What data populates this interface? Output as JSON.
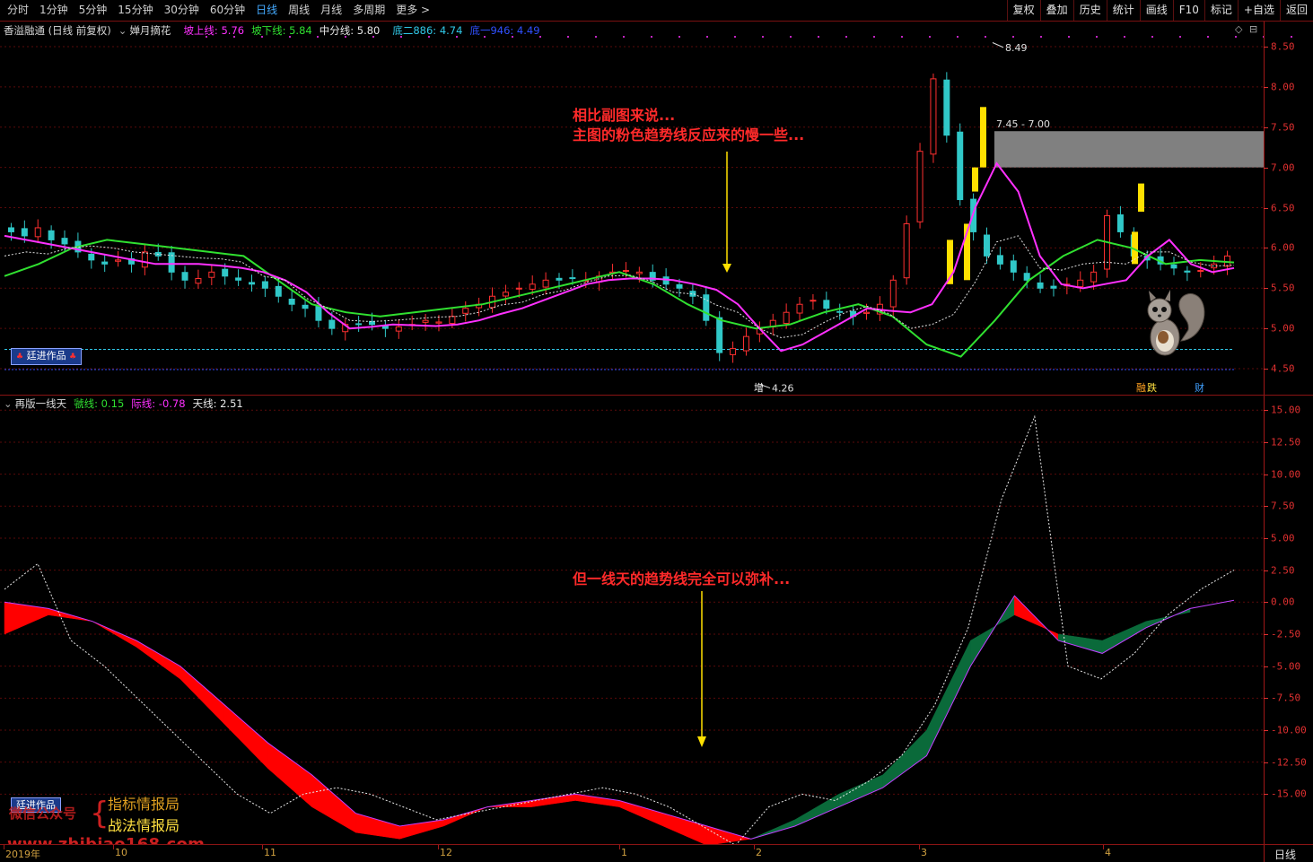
{
  "toolbar": {
    "periods": [
      "分时",
      "1分钟",
      "5分钟",
      "15分钟",
      "30分钟",
      "60分钟",
      "日线",
      "周线",
      "月线",
      "多周期",
      "更多 >"
    ],
    "active_period": "日线",
    "actions": [
      "复权",
      "叠加",
      "历史",
      "统计",
      "画线",
      "F10",
      "标记",
      "+自选",
      "返回"
    ]
  },
  "main_header": {
    "stock": "香溢融通 (日线 前复权)",
    "indicator_name": "婵月摘花",
    "line1_label": "坡上线: 5.76",
    "line2_label": "坡下线: 5.84",
    "line3_label": "中分线: 5.80",
    "line4_label": "底二886: 4.74",
    "line5_label": "底一946: 4.49"
  },
  "sub_header": {
    "indicator_name": "再版一线天",
    "line1_label": "虢线: 0.15",
    "line2_label": "际线: -0.78",
    "line3_label": "天线: 2.51"
  },
  "main_axis": [
    "8.50",
    "8.00",
    "7.50",
    "7.00",
    "6.50",
    "6.00",
    "5.50",
    "5.00",
    "4.50"
  ],
  "sub_axis": [
    "15.00",
    "12.50",
    "10.00",
    "7.50",
    "5.00",
    "2.50",
    "0.00",
    "-2.50",
    "-5.00",
    "-7.50",
    "-10.00",
    "-12.50",
    "-15.00"
  ],
  "x_axis": {
    "labels": [
      "2019年",
      "10",
      "11",
      "12",
      "1",
      "2",
      "3",
      "4"
    ],
    "period_label": "日线"
  },
  "chart_marks": {
    "high_label": "8.49",
    "low_label": "4.26",
    "zone_label": "7.45 - 7.00",
    "event_zeng": "增",
    "event_rong": "融",
    "event_die": "跌",
    "event_cai": "财"
  },
  "annotations": {
    "main_line1": "相比副图来说...",
    "main_line2": "主图的粉色趋势线反应来的慢一些...",
    "sub_line1": "但一线天的趋势线完全可以弥补..."
  },
  "badges": {
    "author_main": "廷进作品",
    "author_sub": "廷进作品"
  },
  "watermark": {
    "left_text": "微信公众号",
    "brace": "{",
    "line1": "指标情报局",
    "line2": "战法情报局",
    "url": "www.zhibiao168.com"
  },
  "colors": {
    "up": "#ff3030",
    "down": "#30c8c8",
    "pink": "#ff30ff",
    "green": "#30e030",
    "yellow": "#ffe000",
    "red_fill": "#ff0000",
    "green_fill": "#0a6a3a",
    "axis": "#e03030"
  },
  "chart_data": {
    "type": "candlestick",
    "main": {
      "ylim": [
        4.3,
        8.6
      ],
      "close": [
        6.2,
        6.15,
        6.25,
        6.1,
        6.05,
        5.95,
        5.85,
        5.8,
        5.85,
        5.8,
        5.95,
        5.9,
        5.7,
        5.6,
        5.62,
        5.7,
        5.65,
        5.6,
        5.55,
        5.5,
        5.4,
        5.3,
        5.25,
        5.1,
        5.0,
        5.05,
        5.05,
        5.05,
        5.0,
        5.02,
        5.05,
        5.1,
        5.08,
        5.15,
        5.25,
        5.3,
        5.4,
        5.45,
        5.5,
        5.55,
        5.6,
        5.6,
        5.62,
        5.6,
        5.65,
        5.7,
        5.72,
        5.7,
        5.6,
        5.55,
        5.5,
        5.4,
        5.1,
        4.7,
        4.75,
        4.9,
        5.0,
        5.1,
        5.2,
        5.3,
        5.35,
        5.25,
        5.2,
        5.15,
        5.2,
        5.3,
        5.6,
        6.3,
        7.2,
        8.1,
        7.4,
        6.6,
        6.2,
        5.9,
        5.8,
        5.7,
        5.6,
        5.5,
        5.5,
        5.55,
        5.6,
        5.7,
        6.4,
        6.2,
        5.9,
        5.85,
        5.8,
        5.75,
        5.7,
        5.72,
        5.8,
        5.9
      ],
      "trend_pink": [
        6.15,
        6.1,
        6.05,
        6.0,
        5.95,
        5.9,
        5.85,
        5.8,
        5.8,
        5.8,
        5.78,
        5.75,
        5.7,
        5.6,
        5.45,
        5.2,
        5.0,
        5.02,
        5.05,
        5.04,
        5.03,
        5.05,
        5.1,
        5.18,
        5.25,
        5.35,
        5.45,
        5.55,
        5.6,
        5.62,
        5.62,
        5.6,
        5.55,
        5.48,
        5.3,
        5.0,
        4.72,
        4.8,
        4.95,
        5.1,
        5.25,
        5.22,
        5.2,
        5.3,
        5.7,
        6.5,
        7.05,
        6.7,
        5.9,
        5.55,
        5.5,
        5.55,
        5.6,
        5.9,
        6.1,
        5.8,
        5.7,
        5.75
      ],
      "trend_green": [
        5.65,
        5.8,
        6.0,
        6.1,
        6.05,
        6.0,
        5.95,
        5.9,
        5.6,
        5.3,
        5.2,
        5.15,
        5.2,
        5.25,
        5.3,
        5.4,
        5.5,
        5.6,
        5.7,
        5.55,
        5.3,
        5.1,
        5.0,
        5.05,
        5.2,
        5.3,
        5.15,
        4.8,
        4.65,
        5.1,
        5.6,
        5.9,
        6.1,
        6.0,
        5.8,
        5.85,
        5.82
      ]
    },
    "sub": {
      "ylim": [
        -17.5,
        16.0
      ],
      "tianxian": [
        1.0,
        3.0,
        -3.0,
        -5.0,
        -7.5,
        -10.0,
        -12.5,
        -15.0,
        -16.5,
        -15.0,
        -14.5,
        -15.0,
        -16.0,
        -17.0,
        -16.5,
        -16.0,
        -15.5,
        -15.0,
        -14.5,
        -15.0,
        -16.0,
        -17.5,
        -19.0,
        -16.0,
        -15.0,
        -15.5,
        -14.0,
        -12.0,
        -8.0,
        -2.0,
        8.0,
        14.5,
        -5.0,
        -6.0,
        -4.0,
        -1.0,
        1.0,
        2.5
      ],
      "guoxian": [
        0.0,
        -0.5,
        -1.5,
        -3.0,
        -5.0,
        -8.0,
        -11.0,
        -13.5,
        -16.5,
        -17.5,
        -17.0,
        -16.0,
        -15.5,
        -15.0,
        -15.5,
        -16.5,
        -17.5,
        -18.5,
        -17.5,
        -16.0,
        -14.5,
        -12.0,
        -5.0,
        0.5,
        -3.0,
        -4.0,
        -2.0,
        -0.5,
        0.15
      ],
      "jixian": [
        -2.5,
        -1.0,
        -1.5,
        -3.5,
        -6.0,
        -9.5,
        -13.0,
        -16.0,
        -18.0,
        -18.5,
        -17.5,
        -16.0,
        -16.0,
        -15.5,
        -16.0,
        -17.5,
        -19.0,
        -18.5,
        -17.0,
        -15.0,
        -13.5,
        -10.0,
        -3.0,
        -1.0,
        -2.5,
        -3.0,
        -1.5,
        -0.78
      ]
    }
  }
}
